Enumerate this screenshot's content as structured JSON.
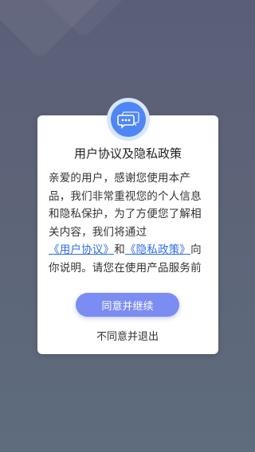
{
  "dialog": {
    "title": "用户协议及隐私政策",
    "body": {
      "text_before": "亲爱的用户，感谢您使用本产品，我们非常重视您的个人信息和隐私保护，为了方便您了解相关内容，我们将通过",
      "link_user_agreement": "《用户协议》",
      "text_and": "和",
      "link_privacy_policy": "《隐私政策》",
      "text_after": "向你说明。请您在使用产品服务前务必确仔"
    },
    "agree_button": "同意并继续",
    "disagree_button": "不同意并退出",
    "icon": "chat-bubble-icon"
  },
  "colors": {
    "accent": "#7b8cf2",
    "link": "#2f6de8",
    "icon": "#4f86f5",
    "background": "#5d6478"
  }
}
